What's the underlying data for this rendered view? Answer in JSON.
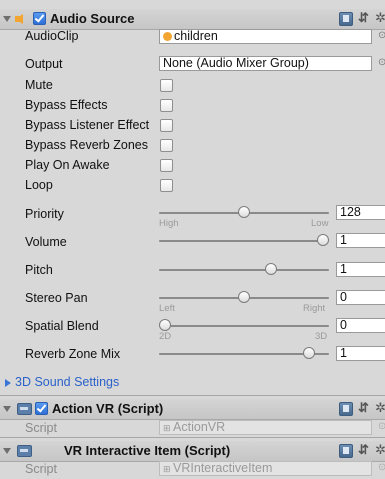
{
  "audio_source": {
    "title": "Audio Source",
    "enabled": true,
    "fields": {
      "audio_clip": {
        "label": "AudioClip",
        "value": "children"
      },
      "output": {
        "label": "Output",
        "value": "None (Audio Mixer Group)"
      },
      "mute": {
        "label": "Mute",
        "checked": false
      },
      "bypass_effects": {
        "label": "Bypass Effects",
        "checked": false
      },
      "bypass_listener": {
        "label": "Bypass Listener Effect",
        "checked": false
      },
      "bypass_reverb": {
        "label": "Bypass Reverb Zones",
        "checked": false
      },
      "play_on_awake": {
        "label": "Play On Awake",
        "checked": false
      },
      "loop": {
        "label": "Loop",
        "checked": false
      }
    },
    "sliders": {
      "priority": {
        "label": "Priority",
        "value": "128",
        "level": 0.5,
        "left_caption": "High",
        "right_caption": "Low"
      },
      "volume": {
        "label": "Volume",
        "value": "1",
        "level": 1.0
      },
      "pitch": {
        "label": "Pitch",
        "value": "1",
        "level": 0.67
      },
      "stereo_pan": {
        "label": "Stereo Pan",
        "value": "0",
        "level": 0.5,
        "left_caption": "Left",
        "right_caption": "Right"
      },
      "spatial_blend": {
        "label": "Spatial Blend",
        "value": "0",
        "level": 0.0,
        "left_caption": "2D",
        "right_caption": "3D"
      },
      "reverb_zone_mix": {
        "label": "Reverb Zone Mix",
        "value": "1",
        "level": 0.91
      }
    },
    "foldout_3d": "3D Sound Settings"
  },
  "action_vr": {
    "title": "Action VR (Script)",
    "enabled": true,
    "script_label": "Script",
    "script_value": "ActionVR"
  },
  "vr_interactive": {
    "title": "VR Interactive Item (Script)",
    "script_label": "Script",
    "script_value": "VRInteractiveItem"
  },
  "icons": [
    "foldout-arrow",
    "audio-source-icon",
    "book-icon",
    "sliders-icon",
    "gear-icon",
    "object-picker-icon",
    "script-icon"
  ],
  "colors": {
    "panel_bg": "#d8d8d8",
    "accent_blue": "#3a76d8",
    "link_blue": "#2a62c9",
    "audio_orange": "#f2a531"
  }
}
